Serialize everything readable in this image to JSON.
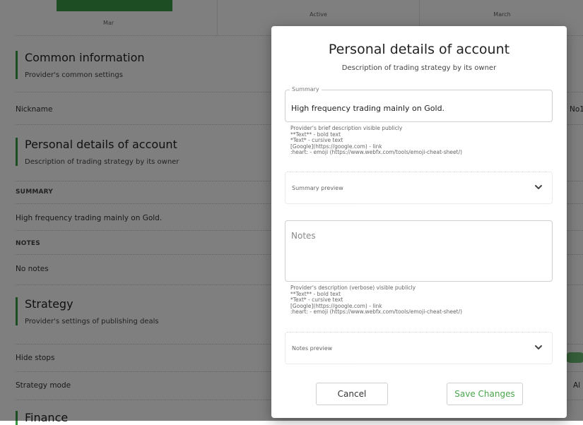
{
  "header": {
    "tabs": [
      {
        "label": "Mar"
      },
      {
        "label": "Active"
      },
      {
        "label": "March"
      }
    ]
  },
  "page": {
    "common": {
      "title": "Common information",
      "subtitle": "Provider's common settings"
    },
    "nickname_label": "Nickname",
    "nickname_value_partial": "No1",
    "personal": {
      "title": "Personal details of account",
      "subtitle": "Description of trading strategy by its owner"
    },
    "summary_label": "SUMMARY",
    "summary_value": "High frequency trading mainly on Gold.",
    "notes_label": "NOTES",
    "notes_value": "No notes",
    "strategy": {
      "title": "Strategy",
      "subtitle": "Provider's settings of publishing deals"
    },
    "hide_stops_label": "Hide stops",
    "strategy_mode_label": "Strategy mode",
    "strategy_mode_value_partial": "Al",
    "finance_title_partial": "Finance"
  },
  "modal": {
    "title": "Personal details of account",
    "subtitle": "Description of trading strategy by its owner",
    "summary_field": {
      "legend": "Summary",
      "value": "High frequency trading mainly on Gold."
    },
    "summary_help": [
      "Provider's brief description visible publicly",
      "**Text** - bold text",
      "*Text* - cursive text",
      "[Google](https://google.com) - link",
      ":heart: - emoji (https://www.webfx.com/tools/emoji-cheat-sheet/)"
    ],
    "summary_preview_label": "Summary preview",
    "notes_field": {
      "placeholder": "Notes"
    },
    "notes_help": [
      "Provider's description (verbose) visible publicly",
      "**Text** - bold text",
      "*Text* - cursive text",
      "[Google](https://google.com) - link",
      ":heart: - emoji (https://www.webfx.com/tools/emoji-cheat-sheet/)"
    ],
    "notes_preview_label": "Notes preview",
    "cancel_label": "Cancel",
    "save_label": "Save Changes"
  },
  "colors": {
    "accent_green": "#3a9a44",
    "save_text": "#48a54a",
    "overlay": "rgba(0,0,0,0.5)"
  },
  "icons": {
    "preview_toggle": "chevron-down-icon",
    "hide_stops_toggle": "toggle-switch"
  }
}
